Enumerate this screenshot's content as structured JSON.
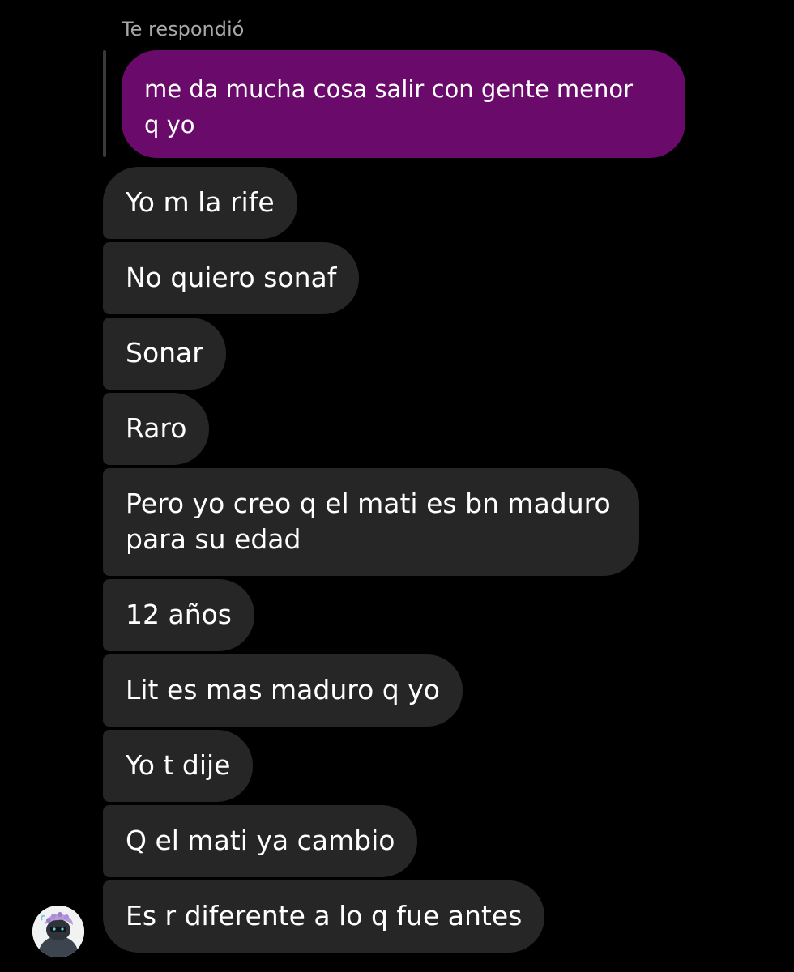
{
  "thread": {
    "reply_label": "Te respondió",
    "quoted_message": "me da mucha cosa salir con gente menor q yo",
    "messages": [
      "Yo m la rife",
      "No quiero sonaf",
      "Sonar",
      "Raro",
      "Pero yo creo q el mati es bn maduro para su edad",
      "12 años",
      "Lit es mas maduro q yo",
      "Yo t dije",
      "Q el mati ya cambio",
      "Es r diferente a lo q fue antes"
    ]
  },
  "avatar": {
    "icon": "user-avatar-icon"
  },
  "colors": {
    "background": "#000000",
    "quoted_bubble": "#6a0a6a",
    "received_bubble": "#262626",
    "reply_label": "#a8a8a8",
    "reply_bar": "#3a3a3a"
  }
}
